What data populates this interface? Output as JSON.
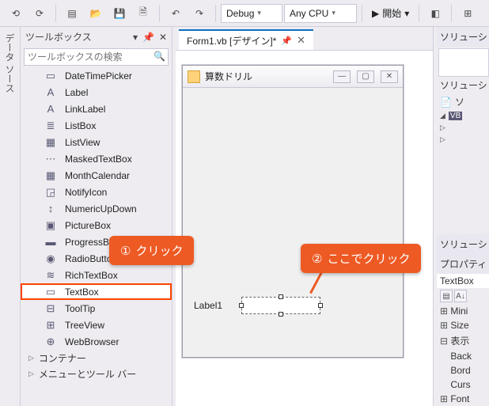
{
  "topbar": {
    "debug_label": "Debug",
    "cpu_label": "Any CPU",
    "start_label": "開始"
  },
  "side_tab": {
    "label": "データ ソース"
  },
  "toolbox": {
    "title": "ツールボックス",
    "search_placeholder": "ツールボックスの検索",
    "items": [
      {
        "icon": "▭",
        "label": "DateTimePicker"
      },
      {
        "icon": "A",
        "label": "Label"
      },
      {
        "icon": "A",
        "label": "LinkLabel"
      },
      {
        "icon": "≣",
        "label": "ListBox"
      },
      {
        "icon": "▦",
        "label": "ListView"
      },
      {
        "icon": "⋯",
        "label": "MaskedTextBox"
      },
      {
        "icon": "▦",
        "label": "MonthCalendar"
      },
      {
        "icon": "◲",
        "label": "NotifyIcon"
      },
      {
        "icon": "↕",
        "label": "NumericUpDown"
      },
      {
        "icon": "▣",
        "label": "PictureBox"
      },
      {
        "icon": "▬",
        "label": "ProgressBar"
      },
      {
        "icon": "◉",
        "label": "RadioButton"
      },
      {
        "icon": "≋",
        "label": "RichTextBox"
      },
      {
        "icon": "▭",
        "label": "TextBox",
        "highlight": true
      },
      {
        "icon": "⊟",
        "label": "ToolTip"
      },
      {
        "icon": "⊞",
        "label": "TreeView"
      },
      {
        "icon": "⊕",
        "label": "WebBrowser"
      }
    ],
    "groups": [
      "コンテナー",
      "メニューとツール バー"
    ]
  },
  "doc_tab": {
    "label": "Form1.vb [デザイン]*"
  },
  "form": {
    "title": "算数ドリル",
    "label1": "Label1"
  },
  "solution": {
    "title": "ソリューシ",
    "subtitle": "ソリューシ",
    "item1": "ソ",
    "item2": "VB",
    "bottom": "ソリューシ"
  },
  "properties": {
    "title": "プロパティ",
    "object": "TextBox",
    "items": [
      {
        "e": "⊞",
        "label": "Mini"
      },
      {
        "e": "⊞",
        "label": "Size"
      },
      {
        "e": "⊟",
        "label": "表示"
      },
      {
        "e": " ",
        "label": "Back"
      },
      {
        "e": " ",
        "label": "Bord"
      },
      {
        "e": " ",
        "label": "Curs"
      },
      {
        "e": "⊞",
        "label": "Font"
      }
    ]
  },
  "callouts": {
    "c1": "クリック",
    "c2": "ここでクリック",
    "n1": "①",
    "n2": "②"
  }
}
